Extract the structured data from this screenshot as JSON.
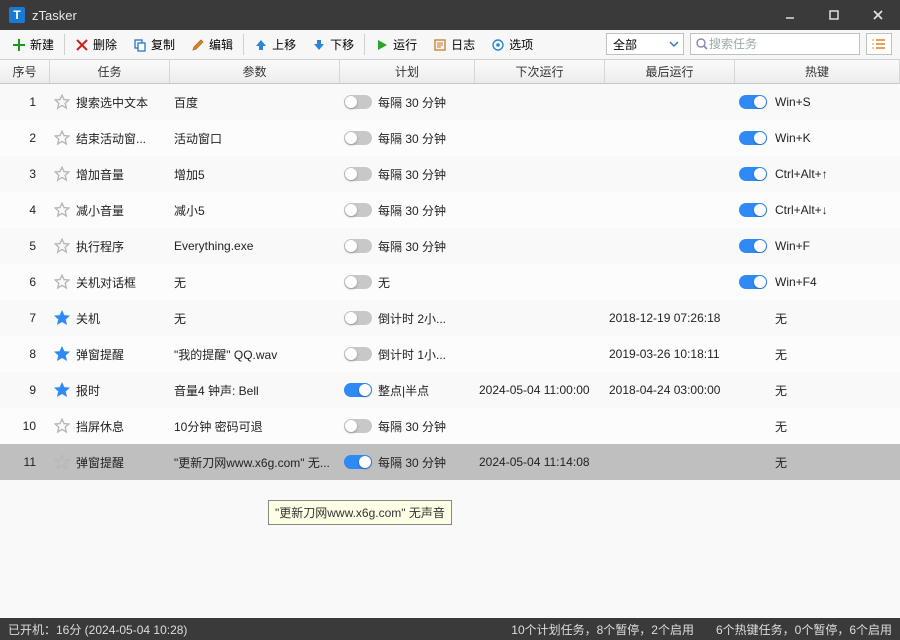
{
  "app": {
    "title": "zTasker"
  },
  "toolbar": {
    "new": "新建",
    "del": "删除",
    "copy": "复制",
    "edit": "编辑",
    "up": "上移",
    "down": "下移",
    "run": "运行",
    "log": "日志",
    "opts": "选项"
  },
  "filter": {
    "selected": "全部"
  },
  "search": {
    "placeholder": "搜索任务"
  },
  "columns": {
    "no": "序号",
    "task": "任务",
    "param": "参数",
    "plan": "计划",
    "next": "下次运行",
    "last": "最后运行",
    "hot": "热键"
  },
  "tooltip": "\"更新刀网www.x6g.com\" 无声音",
  "rows": [
    {
      "no": "1",
      "fav": false,
      "task": "搜索选中文本",
      "param": "百度",
      "plan_on": false,
      "plan": "每隔 30 分钟",
      "next": "",
      "last": "",
      "hot_on": true,
      "hot": "Win+S"
    },
    {
      "no": "2",
      "fav": false,
      "task": "结束活动窗...",
      "param": "活动窗口",
      "plan_on": false,
      "plan": "每隔 30 分钟",
      "next": "",
      "last": "",
      "hot_on": true,
      "hot": "Win+K"
    },
    {
      "no": "3",
      "fav": false,
      "task": "增加音量",
      "param": "增加5",
      "plan_on": false,
      "plan": "每隔 30 分钟",
      "next": "",
      "last": "",
      "hot_on": true,
      "hot": "Ctrl+Alt+↑"
    },
    {
      "no": "4",
      "fav": false,
      "task": "减小音量",
      "param": "减小5",
      "plan_on": false,
      "plan": "每隔 30 分钟",
      "next": "",
      "last": "",
      "hot_on": true,
      "hot": "Ctrl+Alt+↓"
    },
    {
      "no": "5",
      "fav": false,
      "task": "执行程序",
      "param": "Everything.exe",
      "plan_on": false,
      "plan": "每隔 30 分钟",
      "next": "",
      "last": "",
      "hot_on": true,
      "hot": "Win+F"
    },
    {
      "no": "6",
      "fav": false,
      "task": "关机对话框",
      "param": "无",
      "plan_on": false,
      "plan": "无",
      "next": "",
      "last": "",
      "hot_on": true,
      "hot": "Win+F4"
    },
    {
      "no": "7",
      "fav": true,
      "task": "关机",
      "param": "无",
      "plan_on": false,
      "plan": "倒计时 2小...",
      "next": "",
      "last": "2018-12-19 07:26:18",
      "hot_on": false,
      "hot": "无"
    },
    {
      "no": "8",
      "fav": true,
      "task": "弹窗提醒",
      "param": "\"我的提醒\" QQ.wav",
      "plan_on": false,
      "plan": "倒计时 1小...",
      "next": "",
      "last": "2019-03-26 10:18:11",
      "hot_on": false,
      "hot": "无"
    },
    {
      "no": "9",
      "fav": true,
      "task": "报时",
      "param": "音量4 钟声: Bell",
      "plan_on": true,
      "plan": "整点|半点",
      "next": "2024-05-04 11:00:00",
      "last": "2018-04-24 03:00:00",
      "hot_on": false,
      "hot": "无"
    },
    {
      "no": "10",
      "fav": false,
      "task": "挡屏休息",
      "param": "10分钟 密码可退",
      "plan_on": false,
      "plan": "每隔 30 分钟",
      "next": "",
      "last": "",
      "hot_on": false,
      "hot": "无"
    },
    {
      "no": "11",
      "fav": false,
      "task": "弹窗提醒",
      "param": "\"更新刀网www.x6g.com\" 无...",
      "plan_on": true,
      "plan": "每隔 30 分钟",
      "next": "2024-05-04 11:14:08",
      "last": "",
      "hot_on": false,
      "hot": "无",
      "sel": true
    }
  ],
  "status": {
    "left": "已开机：16分 (2024-05-04 10:28)",
    "plan_summary": "10个计划任务，8个暂停，2个启用",
    "hot_summary": "6个热键任务，0个暂停，6个启用"
  }
}
